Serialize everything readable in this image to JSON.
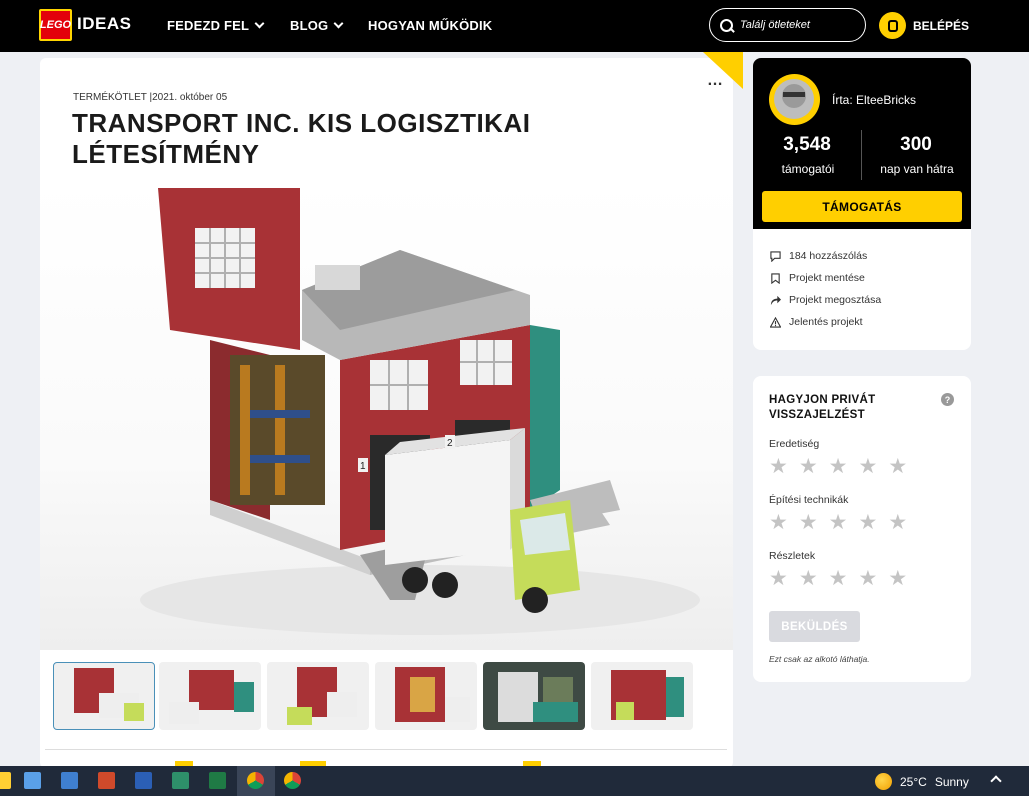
{
  "nav": {
    "logo_brand": "LEGO",
    "logo_text": "IDEAS",
    "items": [
      {
        "label": "FEDEZD FEL"
      },
      {
        "label": "BLOG"
      },
      {
        "label": "HOGYAN MŰKÖDIK"
      }
    ],
    "search_placeholder": "Találj ötleteket",
    "login_label": "BELÉPÉS"
  },
  "project": {
    "meta": "TERMÉKÖTLET |2021. október 05",
    "title": "TRANSPORT INC. KIS LOGISZTIKAI LÉTESÍTMÉNY",
    "more_label": "…",
    "image_labels": [
      "1",
      "2"
    ]
  },
  "thumbnails": [
    {
      "active": true
    },
    {
      "active": false
    },
    {
      "active": false
    },
    {
      "active": false
    },
    {
      "active": false
    },
    {
      "active": false
    }
  ],
  "author": {
    "name": "Írta: ElteeBricks",
    "supporters_count": "3,548",
    "supporters_label": "támogatói",
    "days_count": "300",
    "days_label": "nap van hátra",
    "support_button": "TÁMOGATÁS",
    "actions": [
      {
        "label": "184 hozzászólás",
        "icon": "comment-icon"
      },
      {
        "label": "Projekt mentése",
        "icon": "bookmark-icon"
      },
      {
        "label": "Projekt megosztása",
        "icon": "share-icon"
      },
      {
        "label": "Jelentés projekt",
        "icon": "warning-icon"
      }
    ]
  },
  "feedback": {
    "title": "HAGYJON PRIVÁT VISSZAJELZÉST",
    "help": "?",
    "criteria": [
      {
        "label": "Eredetiség",
        "rating": 0,
        "max": 5
      },
      {
        "label": "Építési technikák",
        "rating": 0,
        "max": 5
      },
      {
        "label": "Részletek",
        "rating": 0,
        "max": 5
      }
    ],
    "submit_label": "BEKÜLDÉS",
    "note": "Ezt csak az alkotó láthatja."
  },
  "taskbar": {
    "temperature": "25°C",
    "condition": "Sunny"
  },
  "colors": {
    "accent": "#ffcf00",
    "nav_bg": "#000000",
    "page_bg": "#eef0f4",
    "taskbar_bg": "#202a3a"
  }
}
